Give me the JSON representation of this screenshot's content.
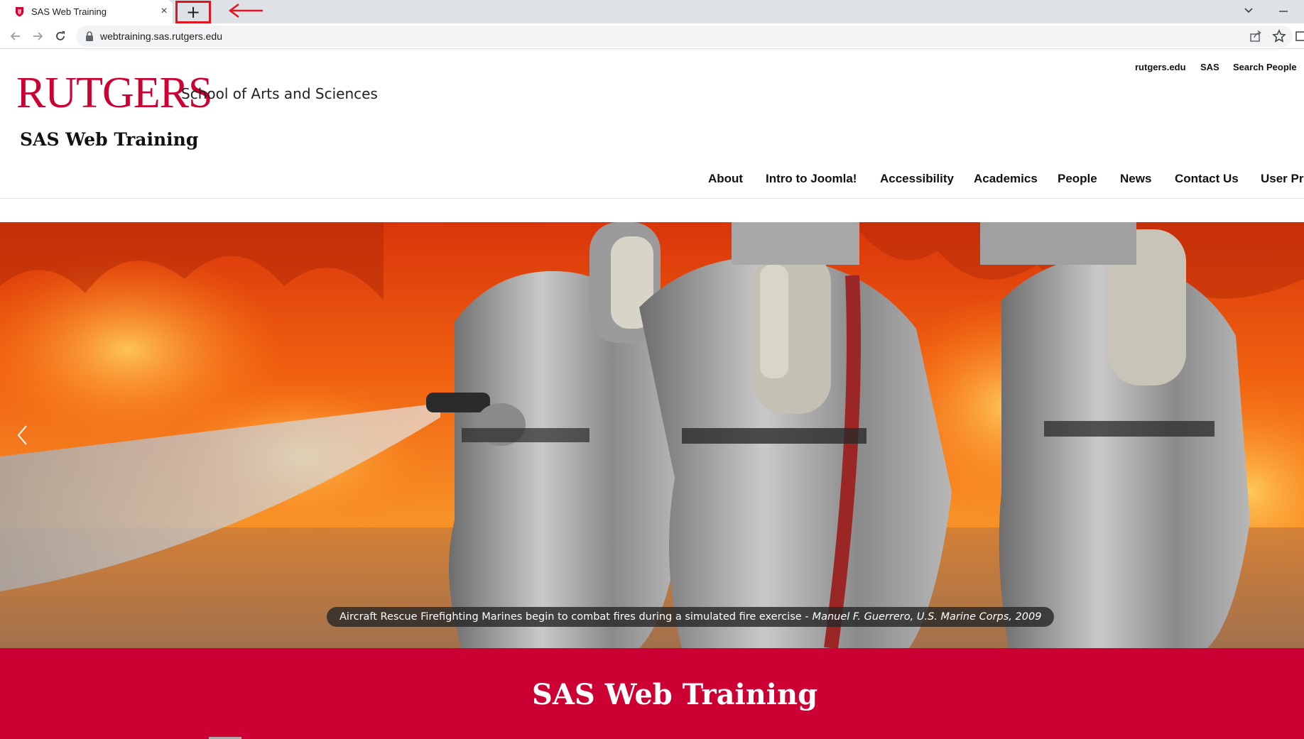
{
  "browser": {
    "tab_title": "SAS Web Training",
    "tab_close": "×",
    "new_tab_label": "+",
    "url": "webtraining.sas.rutgers.edu"
  },
  "header": {
    "logo_text": "RUTGERS",
    "school_name": "School of Arts and Sciences",
    "site_name": "SAS Web Training",
    "utility_links": [
      "rutgers.edu",
      "SAS",
      "Search People"
    ]
  },
  "nav": {
    "items": [
      "About",
      "Intro to Joomla!",
      "Accessibility",
      "Academics",
      "People",
      "News",
      "Contact Us",
      "User Pro"
    ]
  },
  "hero": {
    "caption": "Aircraft Rescue Firefighting Marines begin to combat fires during a simulated fire exercise -",
    "credit": "Manuel F. Guerrero, U.S. Marine Corps, 2009"
  },
  "banner": {
    "title": "SAS Web Training"
  },
  "colors": {
    "brand_red": "#cc0033",
    "annotation_red": "#e0141e",
    "tabstrip": "#dee1e6"
  },
  "icons": [
    "shield-favicon-icon",
    "close-icon",
    "plus-icon",
    "arrow-left-annotation-icon",
    "chevron-down-icon",
    "minimize-icon",
    "back-icon",
    "forward-icon",
    "reload-icon",
    "lock-icon",
    "share-icon",
    "star-icon",
    "side-panel-icon",
    "chevron-left-icon"
  ]
}
